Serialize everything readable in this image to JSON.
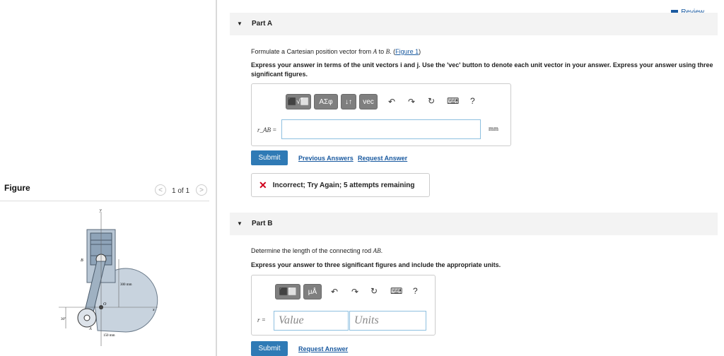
{
  "figure_panel": {
    "header": "Figure",
    "pager": "1 of 1",
    "prev_glyph": "<",
    "next_glyph": ">",
    "diagram": {
      "labels": {
        "y": "y",
        "x": "x",
        "B": "B",
        "A": "A",
        "O": "O",
        "dim_300": "300 mm",
        "dim_150": "150 mm",
        "angle": "30°"
      }
    }
  },
  "review": {
    "label": "Review"
  },
  "part_a": {
    "title": "Part A",
    "prompt_pre": "Formulate a Cartesian position vector from ",
    "prompt_a": "A",
    "prompt_mid": " to ",
    "prompt_b": "B",
    "prompt_post": ". (",
    "figure_link": "Figure 1",
    "prompt_close": ")",
    "instruction": "Express your answer in terms of the unit vectors i and j. Use the 'vec' button to denote each unit vector in your answer. Express your answer using three significant figures.",
    "toolbar": {
      "templates": "⬛√⬜",
      "greek": "ΑΣφ",
      "sort": "↓↑",
      "vec": "vec",
      "undo": "↶",
      "redo": "↷",
      "reset": "↻",
      "keyboard": "⌨",
      "help": "?"
    },
    "field_label": "r_AB =",
    "input_value": "",
    "unit": "mm",
    "submit": "Submit",
    "previous_answers": "Previous Answers",
    "request_answer": "Request Answer",
    "feedback": "Incorrect; Try Again; 5 attempts remaining",
    "feedback_icon": "✕"
  },
  "part_b": {
    "title": "Part B",
    "prompt_pre": "Determine the length of the connecting rod ",
    "prompt_ab": "AB",
    "prompt_post": ".",
    "instruction": "Express your answer to three significant figures and include the appropriate units.",
    "toolbar": {
      "templates": "⬛⬜",
      "units": "μÅ",
      "undo": "↶",
      "redo": "↷",
      "reset": "↻",
      "keyboard": "⌨",
      "help": "?"
    },
    "field_label": "r =",
    "value_placeholder": "Value",
    "units_placeholder": "Units",
    "submit": "Submit",
    "request_answer": "Request Answer"
  }
}
